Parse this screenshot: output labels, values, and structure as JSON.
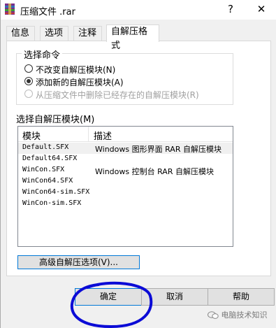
{
  "window": {
    "title": "压缩文件 .rar",
    "help_glyph": "?",
    "close_glyph": "✕"
  },
  "tabs": [
    {
      "label": "信息",
      "active": false
    },
    {
      "label": "选项",
      "active": false
    },
    {
      "label": "注释",
      "active": false
    },
    {
      "label": "自解压格式",
      "active": true
    }
  ],
  "command_group": {
    "title": "选择命令",
    "options": [
      {
        "label": "不改变自解压模块(N)",
        "checked": false,
        "disabled": false
      },
      {
        "label": "添加新的自解压模块(A)",
        "checked": true,
        "disabled": false
      },
      {
        "label": "从压缩文件中删除已经存在的自解压模块(R)",
        "checked": false,
        "disabled": true
      }
    ]
  },
  "module_list": {
    "label": "选择自解压模块(M)",
    "columns": [
      "模块",
      "描述"
    ],
    "rows": [
      {
        "module": "Default.SFX",
        "desc": "Windows 图形界面 RAR 自解压模块",
        "selected": true
      },
      {
        "module": "Default64.SFX",
        "desc": "",
        "selected": false
      },
      {
        "module": "WinCon.SFX",
        "desc": "Windows 控制台 RAR 自解压模块",
        "selected": false
      },
      {
        "module": "WinCon64.SFX",
        "desc": "",
        "selected": false
      },
      {
        "module": "WinCon64-sim.SFX",
        "desc": "",
        "selected": false
      },
      {
        "module": "WinCon-sim.SFX",
        "desc": "",
        "selected": false
      }
    ]
  },
  "advanced_button": "高级自解压选项(V)...",
  "buttons": {
    "ok": "确定",
    "cancel": "取消",
    "help": "帮助"
  },
  "watermark": "电脑技术知识",
  "colors": {
    "annotation": "#0b0bd6",
    "focus": "#0078d7"
  }
}
